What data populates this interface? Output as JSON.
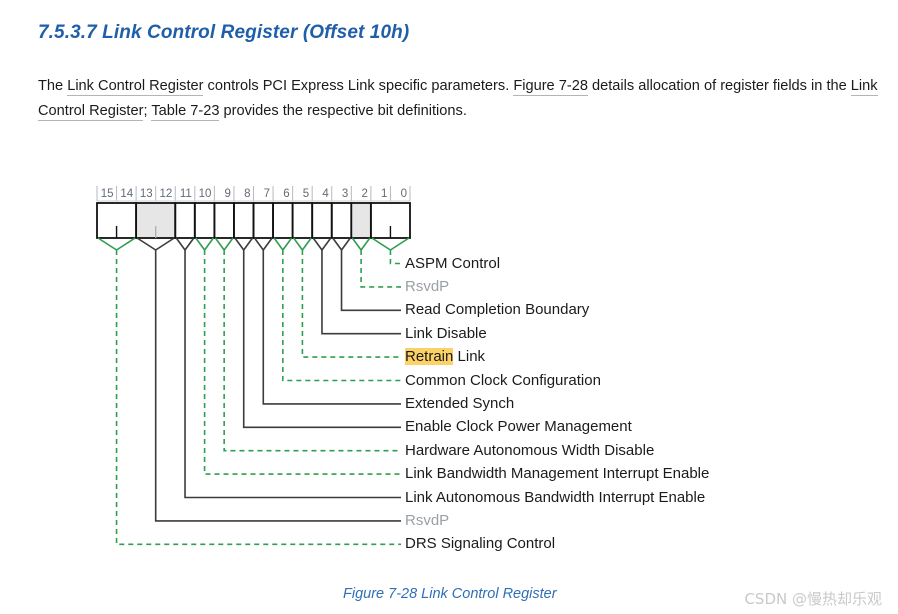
{
  "heading": "7.5.3.7 Link Control Register (Offset 10h)",
  "paragraph": {
    "segments": [
      {
        "text": "The ",
        "xref": false
      },
      {
        "text": "Link Control Register",
        "xref": true
      },
      {
        "text": " controls PCI Express Link specific parameters. ",
        "xref": false
      },
      {
        "text": "Figure  7-28",
        "xref": true
      },
      {
        "text": " details allocation of register fields in the ",
        "xref": false
      },
      {
        "text": "Link Control Register",
        "xref": true
      },
      {
        "text": "; ",
        "xref": false
      },
      {
        "text": "Table  7-23",
        "xref": true
      },
      {
        "text": " provides the respective bit definitions.",
        "xref": false
      }
    ]
  },
  "register": {
    "bit_numbers": [
      "15",
      "14",
      "13",
      "12",
      "11",
      "10",
      "9",
      "8",
      "7",
      "6",
      "5",
      "4",
      "3",
      "2",
      "1",
      "0"
    ],
    "cells": [
      {
        "bits": "15:14",
        "span": 2,
        "reserved": false
      },
      {
        "bits": "13:12",
        "span": 2,
        "reserved": true
      },
      {
        "bits": "11",
        "span": 1,
        "reserved": false
      },
      {
        "bits": "10",
        "span": 1,
        "reserved": false
      },
      {
        "bits": "9",
        "span": 1,
        "reserved": false
      },
      {
        "bits": "8",
        "span": 1,
        "reserved": false
      },
      {
        "bits": "7",
        "span": 1,
        "reserved": false
      },
      {
        "bits": "6",
        "span": 1,
        "reserved": false
      },
      {
        "bits": "5",
        "span": 1,
        "reserved": false
      },
      {
        "bits": "4",
        "span": 1,
        "reserved": false
      },
      {
        "bits": "3",
        "span": 1,
        "reserved": false
      },
      {
        "bits": "2",
        "span": 1,
        "reserved": true
      },
      {
        "bits": "1:0",
        "span": 2,
        "reserved": false
      }
    ],
    "fields": [
      {
        "label": "ASPM Control",
        "bits": "1:0",
        "style": "dashed",
        "reserved": false,
        "highlight": null
      },
      {
        "label": "RsvdP",
        "bits": "2",
        "style": "dashed",
        "reserved": true,
        "highlight": null
      },
      {
        "label": "Read Completion Boundary",
        "bits": "3",
        "style": "solid",
        "reserved": false,
        "highlight": null
      },
      {
        "label": "Link Disable",
        "bits": "4",
        "style": "solid",
        "reserved": false,
        "highlight": null
      },
      {
        "label": "Retrain Link",
        "bits": "5",
        "style": "dashed",
        "reserved": false,
        "highlight": "Retrain"
      },
      {
        "label": "Common Clock Configuration",
        "bits": "6",
        "style": "dashed",
        "reserved": false,
        "highlight": null
      },
      {
        "label": "Extended Synch",
        "bits": "7",
        "style": "solid",
        "reserved": false,
        "highlight": null
      },
      {
        "label": "Enable Clock Power Management",
        "bits": "8",
        "style": "solid",
        "reserved": false,
        "highlight": null
      },
      {
        "label": "Hardware Autonomous Width Disable",
        "bits": "9",
        "style": "dashed",
        "reserved": false,
        "highlight": null
      },
      {
        "label": "Link Bandwidth Management Interrupt Enable",
        "bits": "10",
        "style": "dashed",
        "reserved": false,
        "highlight": null
      },
      {
        "label": "Link Autonomous Bandwidth Interrupt Enable",
        "bits": "11",
        "style": "solid",
        "reserved": false,
        "highlight": null
      },
      {
        "label": "RsvdP",
        "bits": "13:12",
        "style": "solid",
        "reserved": true,
        "highlight": null
      },
      {
        "label": "DRS Signaling Control",
        "bits": "15:14",
        "style": "dashed",
        "reserved": false,
        "highlight": null
      }
    ]
  },
  "caption": "Figure  7-28  Link Control Register",
  "watermark": "CSDN @慢热却乐观",
  "colors": {
    "heading": "#1f5fa9",
    "caption": "#2f6fb5",
    "dashed_leader": "#2e9e4f",
    "solid_leader": "#3c3c3c",
    "reserved_fill": "#e6e6e6",
    "reserved_text": "#9aa0a6",
    "highlight": "#fcd165",
    "xref_underline": "#b4b4b4",
    "watermark": "#c9c9c9"
  }
}
